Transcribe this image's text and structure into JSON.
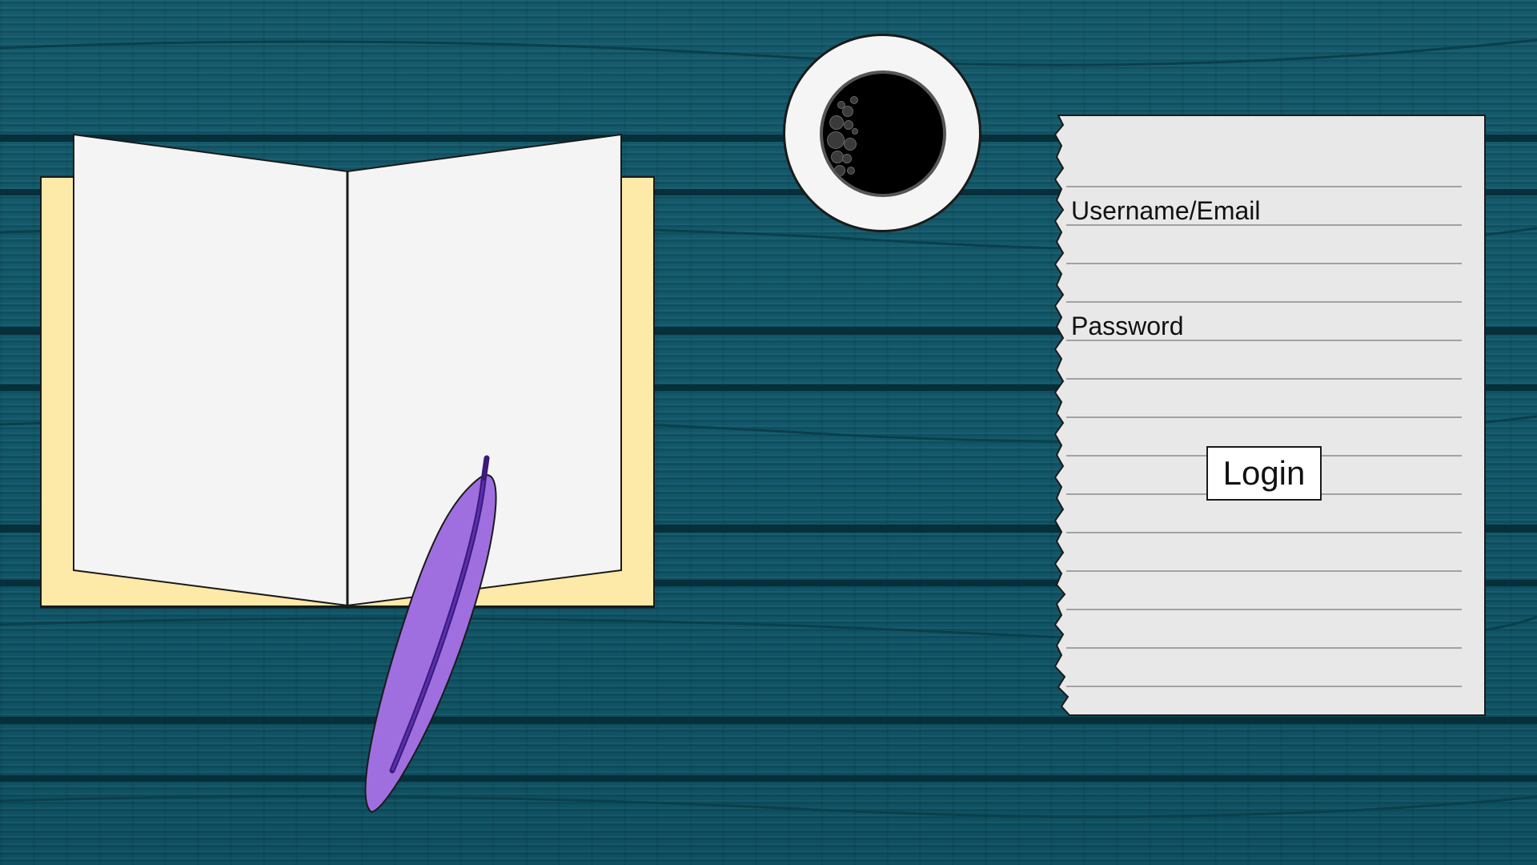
{
  "login_form": {
    "username_label": "Username/Email",
    "username_value": "",
    "password_label": "Password",
    "password_value": "",
    "login_button_label": "Login"
  },
  "colors": {
    "desk": "#11586a",
    "notebook_cover": "#fde9a8",
    "notebook_pages": "#f4f4f4",
    "paper": "#e8e8e8",
    "feather": "#9f6fe0",
    "feather_shaft": "#3b1a7a",
    "coffee": "#000000",
    "saucer": "#f5f5f5"
  },
  "icons": {
    "notebook": "open-notebook-icon",
    "feather": "quill-feather-icon",
    "coffee": "coffee-cup-icon"
  }
}
